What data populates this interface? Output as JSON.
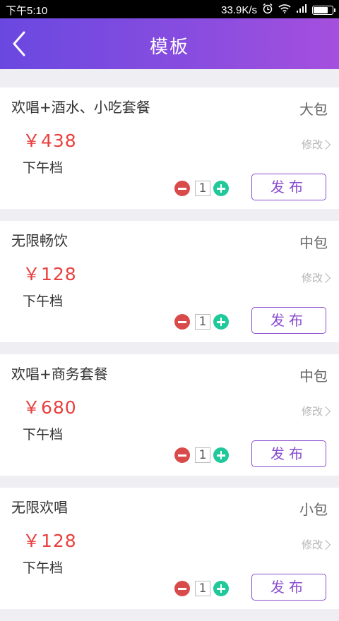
{
  "status_bar": {
    "time": "下午5:10",
    "network_speed": "33.9K/s",
    "icons": [
      "alarm-icon",
      "wifi-icon",
      "signal-icon",
      "battery-icon"
    ]
  },
  "header": {
    "title": "模板",
    "back_icon": "back-chevron-icon"
  },
  "colors": {
    "header_gradient_start": "#6a48e0",
    "header_gradient_end": "#a54fde",
    "price": "#e8403e",
    "publish_accent": "#8a4ccf",
    "minus": "#d94b4b",
    "plus": "#21c99a"
  },
  "templates": [
    {
      "name": "欢唱+酒水、小吃套餐",
      "room": "大包",
      "price": "￥438",
      "slot": "下午档",
      "modify_label": "修改",
      "quantity": "1",
      "publish_label": "发布"
    },
    {
      "name": "无限畅饮",
      "room": "中包",
      "price": "￥128",
      "slot": "下午档",
      "modify_label": "修改",
      "quantity": "1",
      "publish_label": "发布"
    },
    {
      "name": "欢唱+商务套餐",
      "room": "中包",
      "price": "￥680",
      "slot": "下午档",
      "modify_label": "修改",
      "quantity": "1",
      "publish_label": "发布"
    },
    {
      "name": "无限欢唱",
      "room": "小包",
      "price": "￥128",
      "slot": "下午档",
      "modify_label": "修改",
      "quantity": "1",
      "publish_label": "发布"
    }
  ]
}
